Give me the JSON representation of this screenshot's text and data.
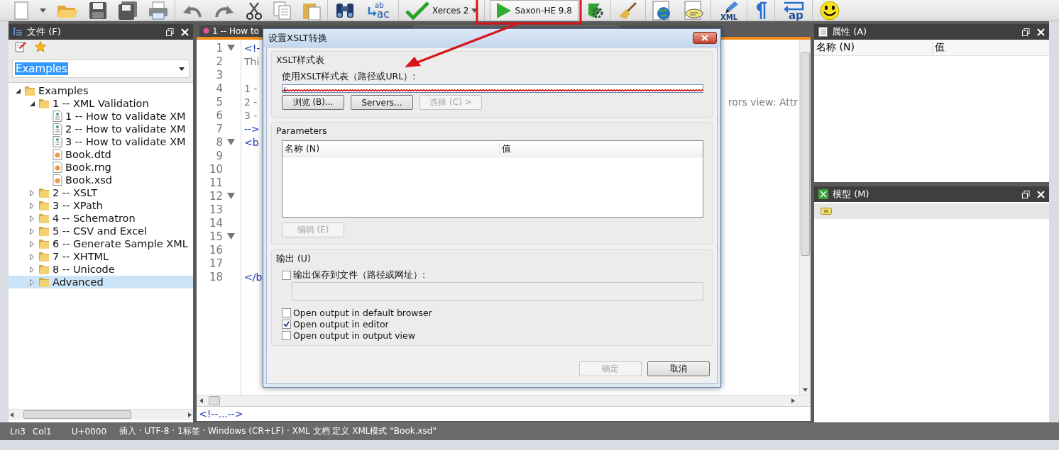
{
  "toolbar": {
    "replace_icon_text": [
      "ab",
      "ac"
    ],
    "validator": "Xerces 2",
    "transformer": "Saxon-HE 9.8",
    "xml_icon_text": "XML",
    "wrap_icon_text": "ap"
  },
  "file_panel": {
    "title": "文件 (F)",
    "filter": {
      "value": "Examples",
      "highlighted": true
    },
    "tree": [
      {
        "label": "Examples",
        "kind": "folder",
        "expanded": true,
        "selected": false,
        "children": [
          {
            "label": "1 -- XML Validation",
            "kind": "folder",
            "expanded": true,
            "selected": false,
            "children": [
              {
                "label": "1 -- How to validate XM",
                "kind": "xml-file",
                "selected": false
              },
              {
                "label": "2 -- How to validate XM",
                "kind": "xml-file",
                "selected": false
              },
              {
                "label": "3 -- How to validate XM",
                "kind": "xml-file",
                "selected": false
              },
              {
                "label": "Book.dtd",
                "kind": "schema-file",
                "selected": false
              },
              {
                "label": "Book.rng",
                "kind": "schema-file",
                "selected": false
              },
              {
                "label": "Book.xsd",
                "kind": "schema-file",
                "selected": false
              }
            ]
          },
          {
            "label": "2 -- XSLT",
            "kind": "folder",
            "expanded": false,
            "selected": false
          },
          {
            "label": "3 -- XPath",
            "kind": "folder",
            "expanded": false,
            "selected": false
          },
          {
            "label": "4 -- Schematron",
            "kind": "folder",
            "expanded": false,
            "selected": false
          },
          {
            "label": "5 -- CSV and Excel",
            "kind": "folder",
            "expanded": false,
            "selected": false
          },
          {
            "label": "6 -- Generate Sample XML",
            "kind": "folder",
            "expanded": false,
            "selected": false
          },
          {
            "label": "7 -- XHTML",
            "kind": "folder",
            "expanded": false,
            "selected": false
          },
          {
            "label": "8 -- Unicode",
            "kind": "folder",
            "expanded": false,
            "selected": false
          },
          {
            "label": "Advanced",
            "kind": "folder",
            "expanded": false,
            "selected": true
          }
        ]
      }
    ]
  },
  "editor": {
    "tabs": [
      {
        "label": "1 -- How to",
        "selected": true
      },
      {
        "selected": false
      }
    ],
    "lines": [
      {
        "number": "1",
        "fold": true,
        "code": "<!-",
        "kind": "tag"
      },
      {
        "number": "2",
        "fold": false,
        "code": "Thi",
        "kind": "comment"
      },
      {
        "number": "3",
        "fold": false
      },
      {
        "number": "4",
        "fold": false,
        "code": "1 -",
        "kind": "comment"
      },
      {
        "number": "5",
        "fold": false,
        "code": "2 -",
        "kind": "comment",
        "right_text": "rors view: Attr"
      },
      {
        "number": "6",
        "fold": false,
        "code": "3 -",
        "kind": "comment"
      },
      {
        "number": "7",
        "fold": false,
        "code": "-->",
        "kind": "tag"
      },
      {
        "number": "8",
        "fold": true,
        "code": "<b",
        "kind": "tag"
      },
      {
        "number": "9",
        "fold": false
      },
      {
        "number": "10",
        "fold": false
      },
      {
        "number": "11",
        "fold": false
      },
      {
        "number": "12",
        "fold": true
      },
      {
        "number": "13",
        "fold": false
      },
      {
        "number": "14",
        "fold": false
      },
      {
        "number": "15",
        "fold": true
      },
      {
        "number": "16",
        "fold": false
      },
      {
        "number": "17",
        "fold": false
      },
      {
        "number": "18",
        "fold": false,
        "code": "</b",
        "kind": "tag"
      }
    ],
    "breadcrumb": "<!--...-->"
  },
  "properties_panel": {
    "title": "属性 (A)",
    "columns": [
      "名称 (N)",
      "值"
    ]
  },
  "model_panel": {
    "title": "模型 (M)"
  },
  "status_bar": {
    "items": [
      "Ln3",
      "Col1",
      "U+0000",
      "插入 · UTF-8 · 1标签 · Windows (CR+LF) · XML 文档 定义 XML模式 \"Book.xsd\""
    ]
  },
  "dialog": {
    "title": "设置XSLT转换",
    "stylesheet": {
      "title": "XSLT样式表",
      "label": "使用XSLT样式表（路径或URL）:",
      "invalid": true,
      "buttons": [
        {
          "label": "浏览 (B)...",
          "disabled": false
        },
        {
          "label": "Servers...",
          "disabled": false
        },
        {
          "label": "选择 (C) >",
          "disabled": true
        }
      ]
    },
    "parameters": {
      "title": "Parameters",
      "columns": [
        "名称 (N)",
        "值"
      ],
      "edit_button": {
        "label": "编辑 (E)",
        "disabled": true
      }
    },
    "output": {
      "title": "输出 (U)",
      "save_to_file": {
        "label": "输出保存到文件（路径或网址）:",
        "checked": false
      },
      "options": [
        {
          "label": "Open output in default browser",
          "checked": false
        },
        {
          "label": "Open output in editor",
          "checked": true
        },
        {
          "label": "Open output in output view",
          "checked": false
        }
      ]
    },
    "buttons": [
      {
        "label": "确定",
        "disabled": true
      },
      {
        "label": "取消",
        "disabled": false
      }
    ]
  }
}
